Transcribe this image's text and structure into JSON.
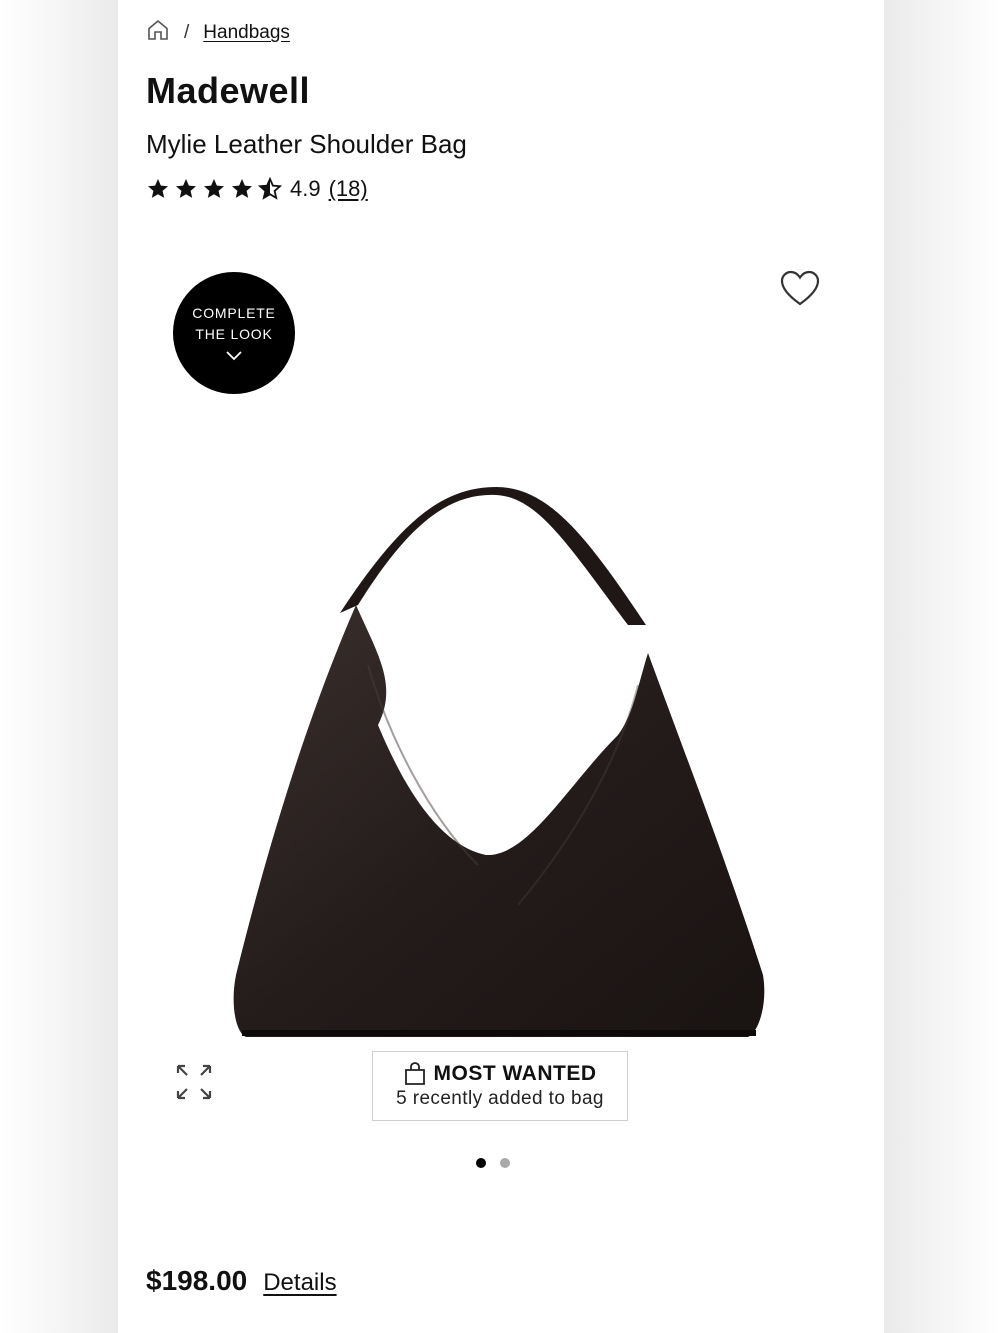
{
  "breadcrumb": {
    "separator": "/",
    "category": "Handbags"
  },
  "product": {
    "brand": "Madewell",
    "name": "Mylie Leather Shoulder Bag",
    "rating_value": "4.9",
    "rating_count": "(18)",
    "stars": 4.5
  },
  "gallery": {
    "complete_look_line1": "COMPLETE",
    "complete_look_line2": "THE LOOK",
    "badge_title": "MOST WANTED",
    "badge_subtitle": "5 recently added to bag",
    "dots": 2,
    "active_dot": 0
  },
  "pricing": {
    "price": "$198.00",
    "details_link": "Details"
  },
  "icons": [
    "home-icon",
    "star-icon",
    "star-half-icon",
    "heart-icon",
    "chevron-down-icon",
    "expand-icon",
    "shopping-bag-icon"
  ],
  "colors": {
    "text": "#111111",
    "accent": "#000000",
    "dot_inactive": "#aaaaaa"
  }
}
